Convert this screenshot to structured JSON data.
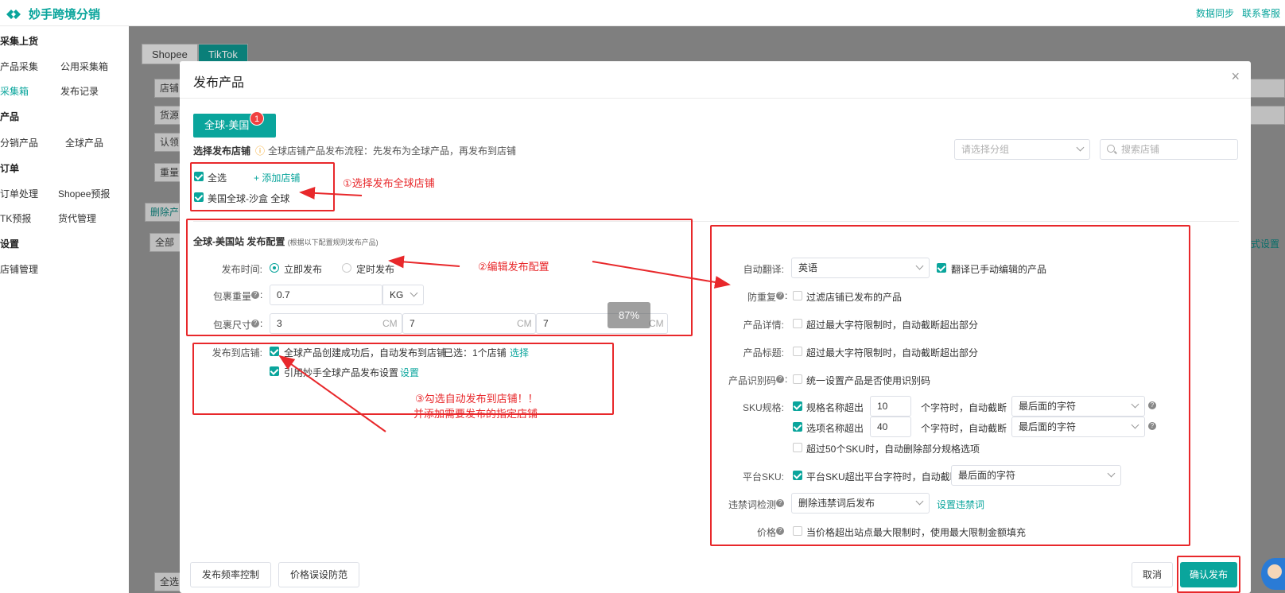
{
  "app": {
    "name": "妙手跨境分销",
    "top_links": [
      "数据同步",
      "联系客服"
    ]
  },
  "sidebar": {
    "sections": [
      {
        "title": "采集上货",
        "items": [
          "产品采集",
          "公用采集箱",
          "采集箱",
          "发布记录"
        ]
      },
      {
        "title": "产品",
        "items": [
          "分销产品",
          "全球产品"
        ]
      },
      {
        "title": "订单",
        "items": [
          "订单处理",
          "Shopee预报",
          "TK预报",
          "货代管理"
        ]
      },
      {
        "title": "设置",
        "items": [
          "店铺管理"
        ]
      }
    ],
    "active_item": "采集箱"
  },
  "background": {
    "tabs": [
      "Shopee",
      "TikTok"
    ],
    "fields": [
      "店铺",
      "货源",
      "认领",
      "重量"
    ],
    "misc": [
      "删除产",
      "全部",
      "全选",
      "式设置"
    ]
  },
  "modal": {
    "title": "发布产品",
    "close_glyph": "×",
    "region_tab": {
      "label": "全球-美国",
      "badge": "1"
    },
    "select_store_label": "选择发布店铺",
    "hint": "全球店铺产品发布流程：先发布为全球产品，再发布到店铺",
    "group_select_placeholder": "请选择分组",
    "search_placeholder": "搜索店铺",
    "select_all": "全选",
    "add_store": "+ 添加店铺",
    "store_item": "美国全球-沙盒 全球",
    "config_title": "全球-美国站 发布配置",
    "config_subtitle": "(根据以下配置规则发布产品)",
    "publish_time": {
      "label": "发布时间:",
      "options": [
        "立即发布",
        "定时发布"
      ],
      "selected": 0
    },
    "weight": {
      "label": "包裹重量",
      "value": "0.7",
      "unit": "KG"
    },
    "size": {
      "label": "包裹尺寸",
      "values": [
        "3",
        "7",
        "7"
      ],
      "unit": "CM"
    },
    "percent_overlay": "87%",
    "publish_to_store": {
      "label": "发布到店铺:",
      "auto_publish": "全球产品创建成功后，自动发布到店铺",
      "selected_text": "已选：1个店铺",
      "select_link": "选择",
      "cite_setting": "引用妙手全球产品发布设置",
      "settings_link": "设置"
    },
    "right": {
      "auto_translate": {
        "label": "自动翻译:",
        "value": "英语",
        "check": "翻译已手动编辑的产品"
      },
      "anti_dup": {
        "label": "防重复",
        "check": "过滤店铺已发布的产品"
      },
      "detail": {
        "label": "产品详情:",
        "check": "超过最大字符限制时，自动截断超出部分"
      },
      "title": {
        "label": "产品标题:",
        "check": "超过最大字符限制时，自动截断超出部分"
      },
      "barcode": {
        "label": "产品识别码",
        "check": "统一设置产品是否使用识别码"
      },
      "sku": {
        "label": "SKU规格:",
        "spec_name": {
          "check": "规格名称超出",
          "value": "10",
          "suffix": "个字符时，自动截断",
          "select": "最后面的字符"
        },
        "option_name": {
          "check": "选项名称超出",
          "value": "40",
          "suffix": "个字符时，自动截断",
          "select": "最后面的字符"
        },
        "over50": "超过50个SKU时，自动删除部分规格选项"
      },
      "platform_sku": {
        "label": "平台SKU:",
        "check": "平台SKU超出平台字符时，自动截断",
        "select": "最后面的字符"
      },
      "banned_words": {
        "label": "违禁词检测",
        "select": "删除违禁词后发布",
        "link": "设置违禁词"
      },
      "price": {
        "label": "价格",
        "check": "当价格超出站点最大限制时，使用最大限制金额填充"
      }
    },
    "footer": {
      "left_buttons": [
        "发布频率控制",
        "价格误设防范"
      ],
      "cancel": "取消",
      "confirm": "确认发布"
    }
  },
  "annotations": {
    "step1": "①选择发布全球店铺",
    "step2": "②编辑发布配置",
    "step3_line1": "③勾选自动发布到店铺！！",
    "step3_line2": "并添加需要发布的指定店铺"
  },
  "colors": {
    "accent": "#0aa59c",
    "annotation": "#e8282b",
    "badge": "#f04141"
  }
}
